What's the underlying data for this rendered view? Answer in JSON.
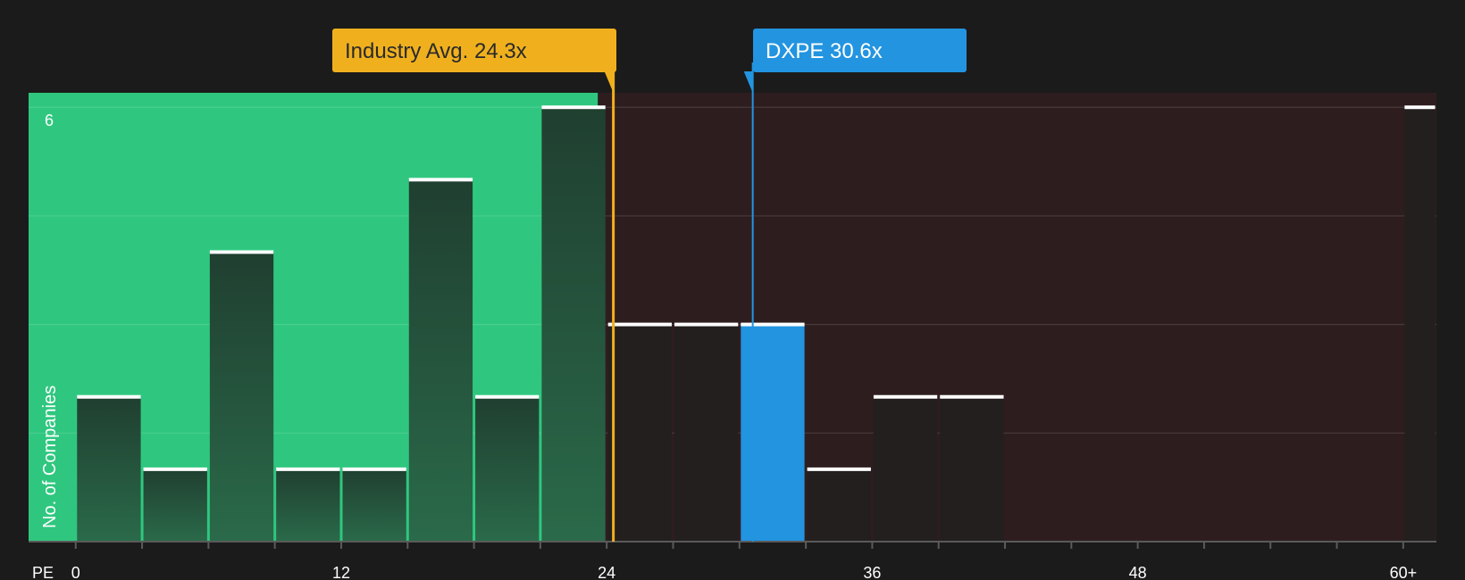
{
  "chart_data": {
    "type": "bar",
    "xlabel": "PE",
    "ylabel": "No. of Companies",
    "x_tick_labels": [
      "0",
      "12",
      "24",
      "36",
      "48",
      "60+"
    ],
    "x_tick_values": [
      0,
      12,
      24,
      36,
      48,
      60
    ],
    "y_tick_labels": [
      "6"
    ],
    "y_tick_values": [
      6
    ],
    "xlim": [
      -2.13,
      61.5
    ],
    "ylim": [
      0,
      6.2
    ],
    "bin_width": 3,
    "bins": [
      {
        "x0": 0,
        "x1": 3,
        "count": 2
      },
      {
        "x0": 3,
        "x1": 6,
        "count": 1
      },
      {
        "x0": 6,
        "x1": 9,
        "count": 4
      },
      {
        "x0": 9,
        "x1": 12,
        "count": 1
      },
      {
        "x0": 12,
        "x1": 15,
        "count": 1
      },
      {
        "x0": 15,
        "x1": 18,
        "count": 5
      },
      {
        "x0": 18,
        "x1": 21,
        "count": 2
      },
      {
        "x0": 21,
        "x1": 24,
        "count": 6
      },
      {
        "x0": 24,
        "x1": 27,
        "count": 3
      },
      {
        "x0": 27,
        "x1": 30,
        "count": 3
      },
      {
        "x0": 30,
        "x1": 33,
        "count": 3,
        "highlight": true
      },
      {
        "x0": 33,
        "x1": 36,
        "count": 1
      },
      {
        "x0": 36,
        "x1": 39,
        "count": 2
      },
      {
        "x0": 39,
        "x1": 42,
        "count": 2
      },
      {
        "x0": 60,
        "x1": 61.5,
        "count": 6
      }
    ],
    "fair_region_end": 23.6,
    "industry_avg": {
      "label": "Industry Avg. 24.3x",
      "value": 24.3
    },
    "company": {
      "label": "DXPE 30.6x",
      "value": 30.6
    },
    "grid": true,
    "colors": {
      "background": "#1b1b1b",
      "fair_region": "#2fc77f",
      "expensive_region": "#2e1d1f",
      "bar_in_fair": "#234a36",
      "bar_in_expensive": "#231f1f",
      "highlight": "#2394e0",
      "industry": "#f0b01e",
      "company": "#2394e0",
      "cap": "#ffffff",
      "axis": "#5a5a5a"
    }
  }
}
